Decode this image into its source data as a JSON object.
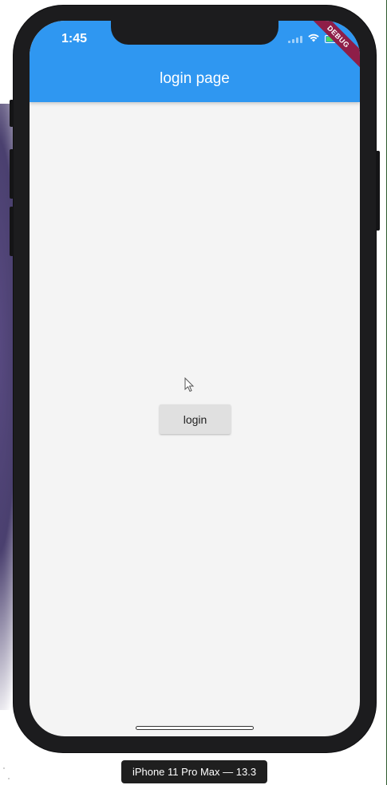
{
  "status_bar": {
    "time": "1:45",
    "icons": [
      "signal-icon",
      "wifi-icon",
      "battery-icon"
    ]
  },
  "debug_banner": {
    "label": "DEBUG"
  },
  "appbar": {
    "title": "login page"
  },
  "body": {
    "login_button_label": "login"
  },
  "simulator": {
    "device_label": "iPhone 11 Pro Max — 13.3"
  },
  "colors": {
    "appbar": "#2f97f1",
    "screen_background": "#f4f4f4",
    "button": "#e0e0e0",
    "debug_ribbon": "#8e1e48",
    "frame": "#1c1c1e"
  }
}
